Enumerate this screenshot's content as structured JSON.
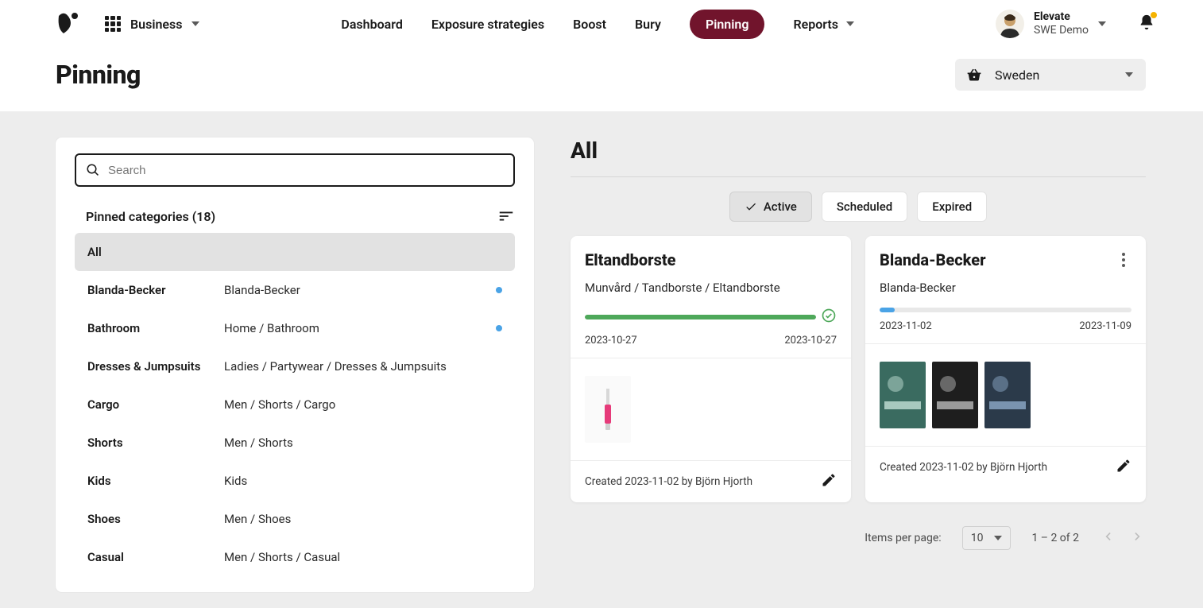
{
  "colors": {
    "brand_pill": "#71142c",
    "progress_green": "#4ea85a",
    "progress_blue": "#4aa3e6",
    "grey_bg": "#ededed"
  },
  "header": {
    "workspace_label": "Business",
    "nav": [
      {
        "label": "Dashboard",
        "active": false
      },
      {
        "label": "Exposure strategies",
        "active": false
      },
      {
        "label": "Boost",
        "active": false
      },
      {
        "label": "Bury",
        "active": false
      },
      {
        "label": "Pinning",
        "active": true
      },
      {
        "label": "Reports",
        "active": false,
        "dropdown": true
      }
    ],
    "user": {
      "line1": "Elevate",
      "line2": "SWE Demo"
    }
  },
  "page": {
    "title": "Pinning",
    "market": "Sweden"
  },
  "sidebar": {
    "search_placeholder": "Search",
    "list_title": "Pinned categories (18)",
    "items": [
      {
        "name": "All",
        "path": "",
        "scheduled": false,
        "selected": true
      },
      {
        "name": "Blanda-Becker",
        "path": "Blanda-Becker",
        "scheduled": true
      },
      {
        "name": "Bathroom",
        "path": "Home / Bathroom",
        "scheduled": true
      },
      {
        "name": "Dresses & Jumpsuits",
        "path": "Ladies / Partywear / Dresses & Jumpsuits",
        "scheduled": false
      },
      {
        "name": "Cargo",
        "path": "Men / Shorts / Cargo",
        "scheduled": false
      },
      {
        "name": "Shorts",
        "path": "Men / Shorts",
        "scheduled": false
      },
      {
        "name": "Kids",
        "path": "Kids",
        "scheduled": false
      },
      {
        "name": "Shoes",
        "path": "Men / Shoes",
        "scheduled": false
      },
      {
        "name": "Casual",
        "path": "Men / Shorts / Casual",
        "scheduled": false
      }
    ]
  },
  "content": {
    "title": "All",
    "tabs": [
      {
        "label": "Active",
        "active": true
      },
      {
        "label": "Scheduled",
        "active": false
      },
      {
        "label": "Expired",
        "active": false
      }
    ],
    "cards": [
      {
        "title": "Eltandborste",
        "subtitle": "Munvård / Tandborste / Eltandborste",
        "progress_percent": 100,
        "progress_color": "#4ea85a",
        "complete": true,
        "start_date": "2023-10-27",
        "end_date": "2023-10-27",
        "created": "Created 2023-11-02 by Björn Hjorth",
        "thumb_count": 1,
        "menu": false
      },
      {
        "title": "Blanda-Becker",
        "subtitle": "Blanda-Becker",
        "progress_percent": 6,
        "progress_color": "#4aa3e6",
        "complete": false,
        "start_date": "2023-11-02",
        "end_date": "2023-11-09",
        "created": "Created 2023-11-02 by Björn Hjorth",
        "thumb_count": 3,
        "menu": true
      }
    ]
  },
  "pager": {
    "label": "Items per page:",
    "page_size": "10",
    "range": "1 – 2 of 2",
    "prev_enabled": false,
    "next_enabled": false
  }
}
